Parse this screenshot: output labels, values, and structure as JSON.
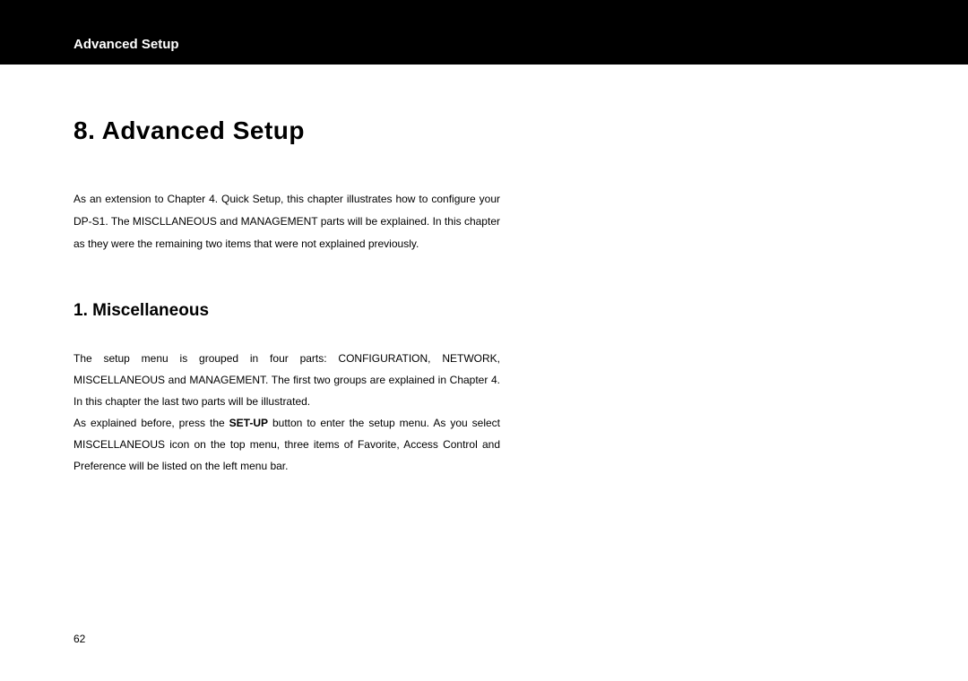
{
  "header": {
    "title": "Advanced Setup"
  },
  "chapter": {
    "title": "8. Advanced Setup",
    "intro": "As an extension to Chapter 4. Quick Setup, this chapter illustrates how to configure your DP-S1. The MISCLLANEOUS and MANAGEMENT parts will be explained. In this chapter as they were the remaining two items that were not explained previously."
  },
  "section": {
    "title": "1. Miscellaneous",
    "paragraph1": "The setup menu is grouped in four parts: CONFIGURATION, NETWORK, MISCELLANEOUS and MANAGEMENT. The first two groups are explained in Chapter 4. In this chapter the last two parts will be illustrated.",
    "paragraph2_pre": "As explained before, press the ",
    "paragraph2_bold": "SET-UP",
    "paragraph2_post": " button to enter the setup menu. As you select MISCELLANEOUS icon on the top menu, three items of Favorite, Access Control and Preference will be listed on the left menu bar."
  },
  "page_number": "62"
}
